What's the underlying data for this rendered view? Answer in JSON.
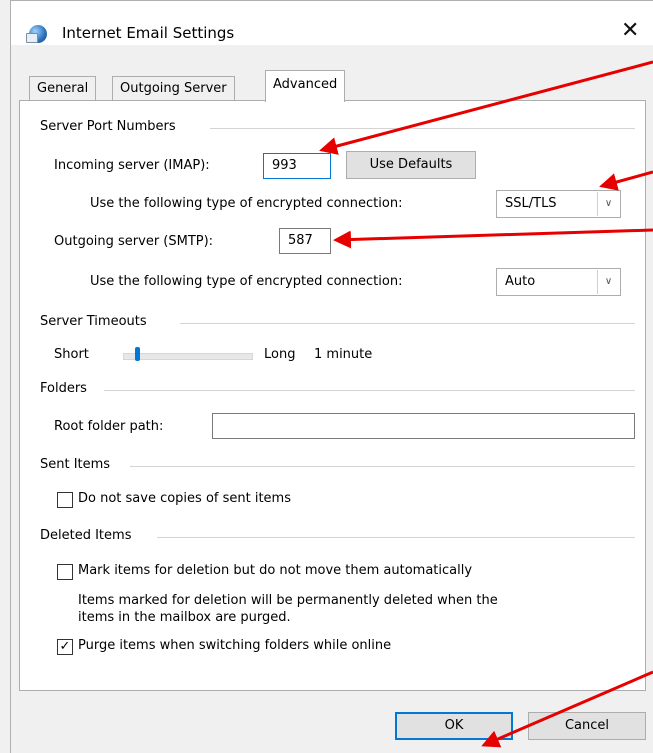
{
  "window": {
    "title": "Internet Email Settings",
    "close_glyph": "✕"
  },
  "tabs": [
    {
      "label": "General",
      "active": false
    },
    {
      "label": "Outgoing Server",
      "active": false
    },
    {
      "label": "Advanced",
      "active": true
    }
  ],
  "server_ports": {
    "section_label": "Server Port Numbers",
    "incoming_label": "Incoming server (IMAP):",
    "incoming_value": "993",
    "use_defaults_label": "Use Defaults",
    "incoming_encryption_label": "Use the following type of encrypted connection:",
    "incoming_encryption_value": "SSL/TLS",
    "outgoing_label": "Outgoing server (SMTP):",
    "outgoing_value": "587",
    "outgoing_encryption_label": "Use the following type of encrypted connection:",
    "outgoing_encryption_value": "Auto"
  },
  "timeouts": {
    "section_label": "Server Timeouts",
    "short_label": "Short",
    "long_label": "Long",
    "value_text": "1 minute"
  },
  "folders": {
    "section_label": "Folders",
    "root_label": "Root folder path:",
    "root_value": ""
  },
  "sent_items": {
    "section_label": "Sent Items",
    "no_copies_label": "Do not save copies of sent items",
    "no_copies_checked": false
  },
  "deleted_items": {
    "section_label": "Deleted Items",
    "mark_label": "Mark items for deletion but do not move them automatically",
    "mark_checked": false,
    "note_line1": "Items marked for deletion will be permanently deleted when the",
    "note_line2": "items in the mailbox are purged.",
    "purge_label": "Purge items when switching folders while online",
    "purge_checked": true,
    "check_glyph": "✓"
  },
  "buttons": {
    "ok_label": "OK",
    "cancel_label": "Cancel"
  },
  "colors": {
    "accent": "#0078d7",
    "annotation_arrow": "#e60000"
  }
}
